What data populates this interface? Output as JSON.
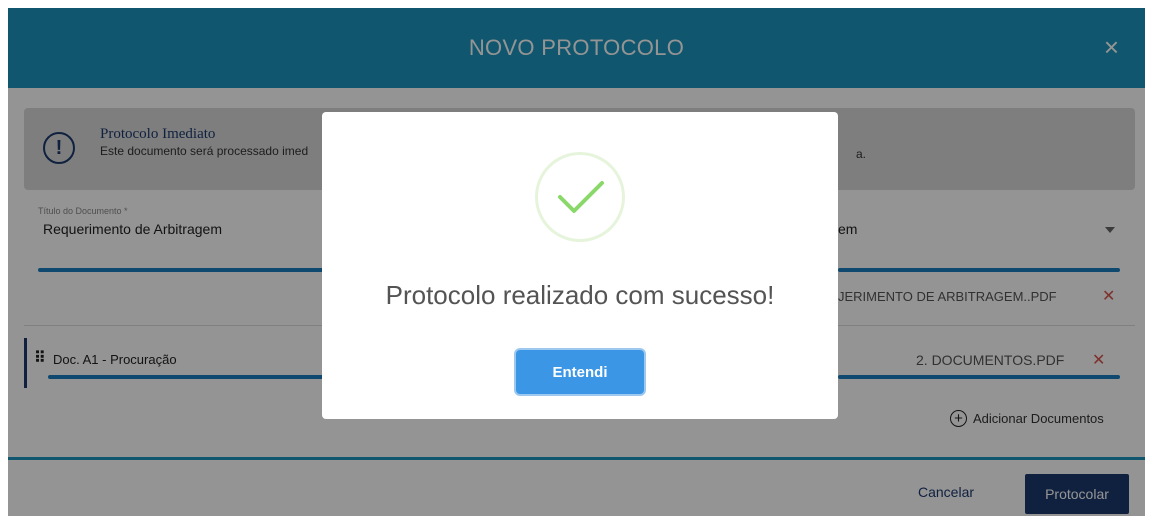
{
  "header": {
    "title": "NOVO PROTOCOLO",
    "close_glyph": "×"
  },
  "alert": {
    "icon": "exclamation-circle-icon",
    "title": "Protocolo Imediato",
    "text": "Este documento será processado imed",
    "text_tail": "a."
  },
  "document": {
    "title_label": "Título do Documento *",
    "title_value": "Requerimento de Arbitragem",
    "type_value_tail": "em",
    "main_file": "JERIMENTO DE ARBITRAGEM..PDF"
  },
  "attachments": [
    {
      "label": "Doc. A1 - Procuração",
      "file": "2. DOCUMENTOS.PDF"
    }
  ],
  "add_documents_label": "Adicionar Documentos",
  "footer": {
    "cancel": "Cancelar",
    "submit": "Protocolar"
  },
  "modal": {
    "message": "Protocolo realizado com sucesso!",
    "button": "Entendi",
    "icon": "check-icon"
  },
  "colors": {
    "header": "#1a95bd",
    "primary_dark": "#1d3a6e",
    "confirm_button": "#3b97e5",
    "remove": "#d9534f",
    "check": "#8ad86a"
  }
}
